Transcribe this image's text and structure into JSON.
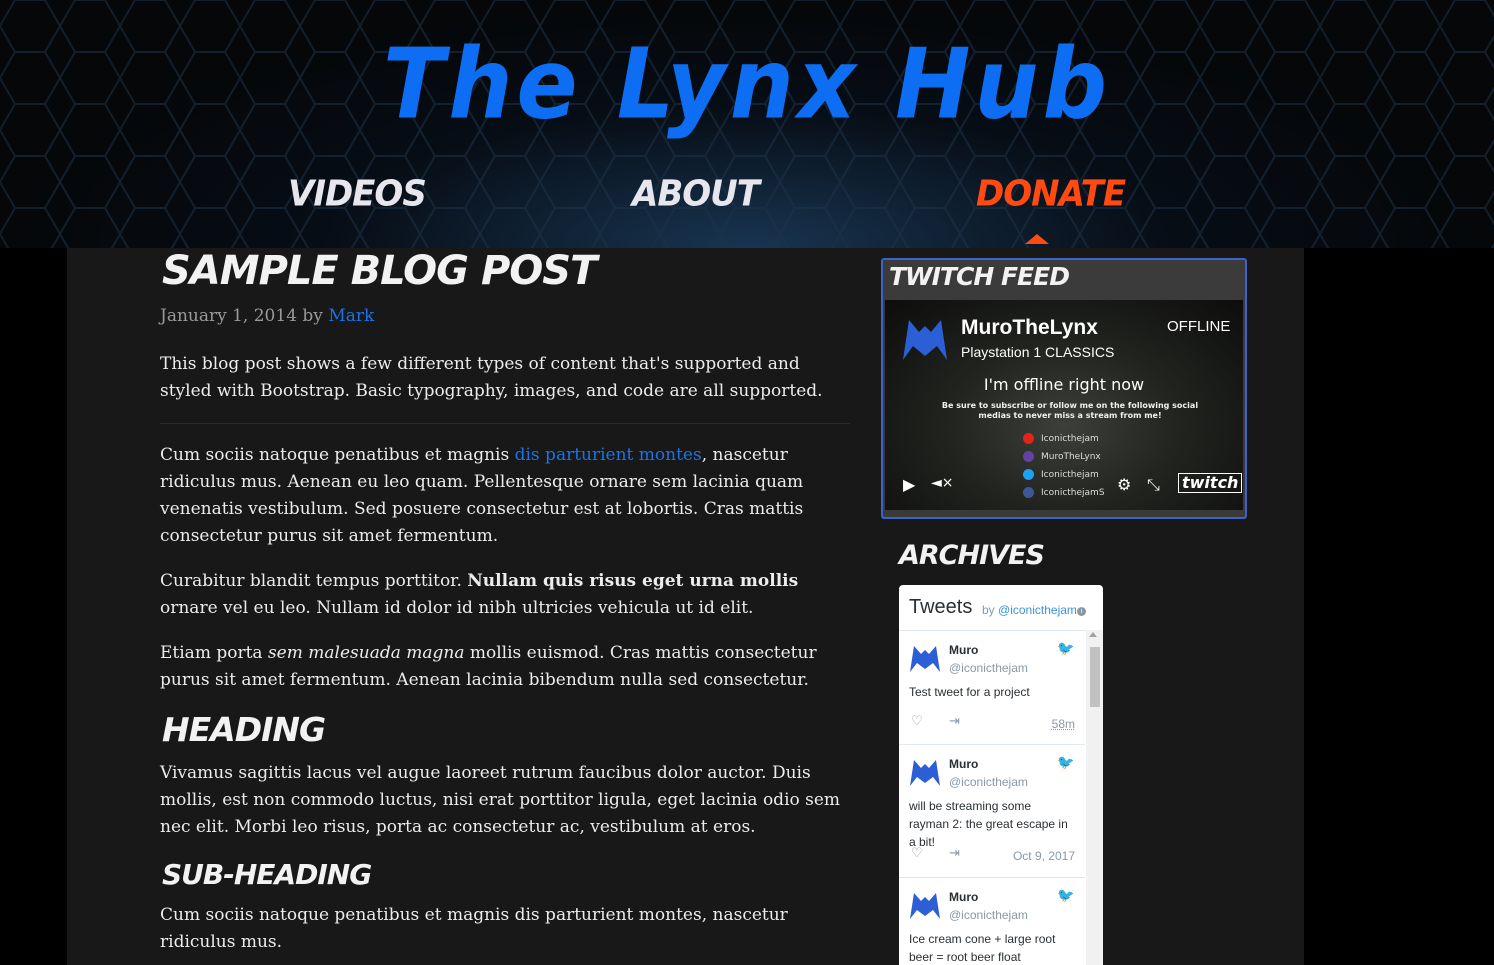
{
  "site": {
    "title": "The Lynx Hub",
    "accent_color": "#0d6ef4",
    "active_color": "#ff4a12"
  },
  "nav": {
    "items": [
      {
        "label": "Videos",
        "active": false
      },
      {
        "label": "About",
        "active": false
      },
      {
        "label": "Donate",
        "active": true
      }
    ]
  },
  "post": {
    "title": "Sample blog post",
    "date": "January 1, 2014",
    "by": "by",
    "author": "Mark",
    "intro": "This blog post shows a few different types of content that's supported and styled with Bootstrap. Basic typography, images, and code are all supported.",
    "p1_a": "Cum sociis natoque penatibus et magnis ",
    "p1_link": "dis parturient montes",
    "p1_b": ", nascetur ridiculus mus. Aenean eu leo quam. Pellentesque ornare sem lacinia quam venenatis vestibulum. Sed posuere consectetur est at lobortis. Cras mattis consectetur purus sit amet fermentum.",
    "p2_a": "Curabitur blandit tempus porttitor. ",
    "p2_bold": "Nullam quis risus eget urna mollis",
    "p2_b": " ornare vel eu leo. Nullam id dolor id nibh ultricies vehicula ut id elit.",
    "p3_a": "Etiam porta ",
    "p3_em": "sem malesuada magna",
    "p3_b": " mollis euismod. Cras mattis consectetur purus sit amet fermentum. Aenean lacinia bibendum nulla sed consectetur.",
    "heading": "Heading",
    "heading_text": "Vivamus sagittis lacus vel augue laoreet rutrum faucibus dolor auctor. Duis mollis, est non commodo luctus, nisi erat porttitor ligula, eget lacinia odio sem nec elit. Morbi leo risus, porta ac consectetur ac, vestibulum at eros.",
    "subheading": "Sub-heading",
    "subheading_text": "Cum sociis natoque penatibus et magnis dis parturient montes, nascetur ridiculus mus."
  },
  "twitch": {
    "title": "Twitch Feed",
    "channel": "MuroTheLynx",
    "game": "Playstation 1 CLASSICS",
    "status": "OFFLINE",
    "offline_title": "I'm offline right now",
    "offline_sub": "Be sure to subscribe or follow me on the following social medias to never miss a stream from me!",
    "socials": [
      {
        "name": "Iconicthejam",
        "icon": "youtube-icon",
        "color": "#e62117"
      },
      {
        "name": "MuroTheLynx",
        "icon": "twitch-icon",
        "color": "#6441a5"
      },
      {
        "name": "Iconicthejam",
        "icon": "twitter-icon",
        "color": "#1da1f2"
      },
      {
        "name": "IconicthejamS",
        "icon": "facebook-icon",
        "color": "#3b5998"
      }
    ],
    "logo": "twitch"
  },
  "sidebar": {
    "archives": "Archives"
  },
  "tweets": {
    "title": "Tweets",
    "by": "by",
    "handle": "@iconicthejam",
    "items": [
      {
        "name": "Muro",
        "handle": "@iconicthejam",
        "text": "Test tweet for a project",
        "time": "58m"
      },
      {
        "name": "Muro",
        "handle": "@iconicthejam",
        "text": "will be streaming some rayman 2: the great escape in a bit!",
        "time": "Oct 9, 2017"
      },
      {
        "name": "Muro",
        "handle": "@iconicthejam",
        "text": "Ice cream cone + large root beer = root beer float",
        "time": ""
      }
    ]
  }
}
